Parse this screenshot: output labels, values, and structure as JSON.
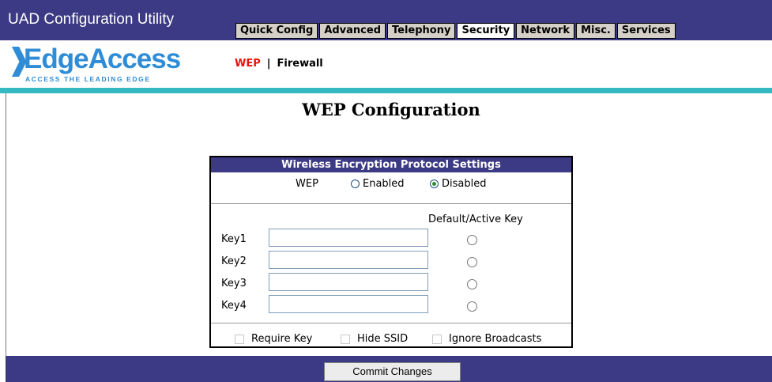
{
  "app": {
    "title": "UAD Configuration Utility"
  },
  "nav": {
    "tabs": [
      {
        "label": "Quick Config",
        "active": false
      },
      {
        "label": "Advanced",
        "active": false
      },
      {
        "label": "Telephony",
        "active": false
      },
      {
        "label": "Security",
        "active": true
      },
      {
        "label": "Network",
        "active": false
      },
      {
        "label": "Misc.",
        "active": false
      },
      {
        "label": "Services",
        "active": false
      }
    ]
  },
  "brand": {
    "name": "EdgeAccess",
    "tagline": "ACCESS THE LEADING EDGE",
    "color": "#2f8cd6"
  },
  "subnav": {
    "wep": "WEP",
    "separator": "|",
    "firewall": "Firewall"
  },
  "page": {
    "title": "WEP Configuration"
  },
  "wep_panel": {
    "header": "Wireless Encryption Protocol Settings",
    "wep_label": "WEP",
    "enabled_label": "Enabled",
    "disabled_label": "Disabled",
    "selected": "Disabled",
    "default_key_label": "Default/Active Key",
    "keys": [
      {
        "label": "Key1",
        "value": ""
      },
      {
        "label": "Key2",
        "value": ""
      },
      {
        "label": "Key3",
        "value": ""
      },
      {
        "label": "Key4",
        "value": ""
      }
    ],
    "require_key_label": "Require Key",
    "hide_ssid_label": "Hide SSID",
    "ignore_broadcasts_label": "Ignore Broadcasts"
  },
  "actions": {
    "commit_label": "Commit Changes"
  },
  "colors": {
    "navy": "#3c3a84",
    "teal": "#35b9c2",
    "wep_red": "#e8140c"
  }
}
